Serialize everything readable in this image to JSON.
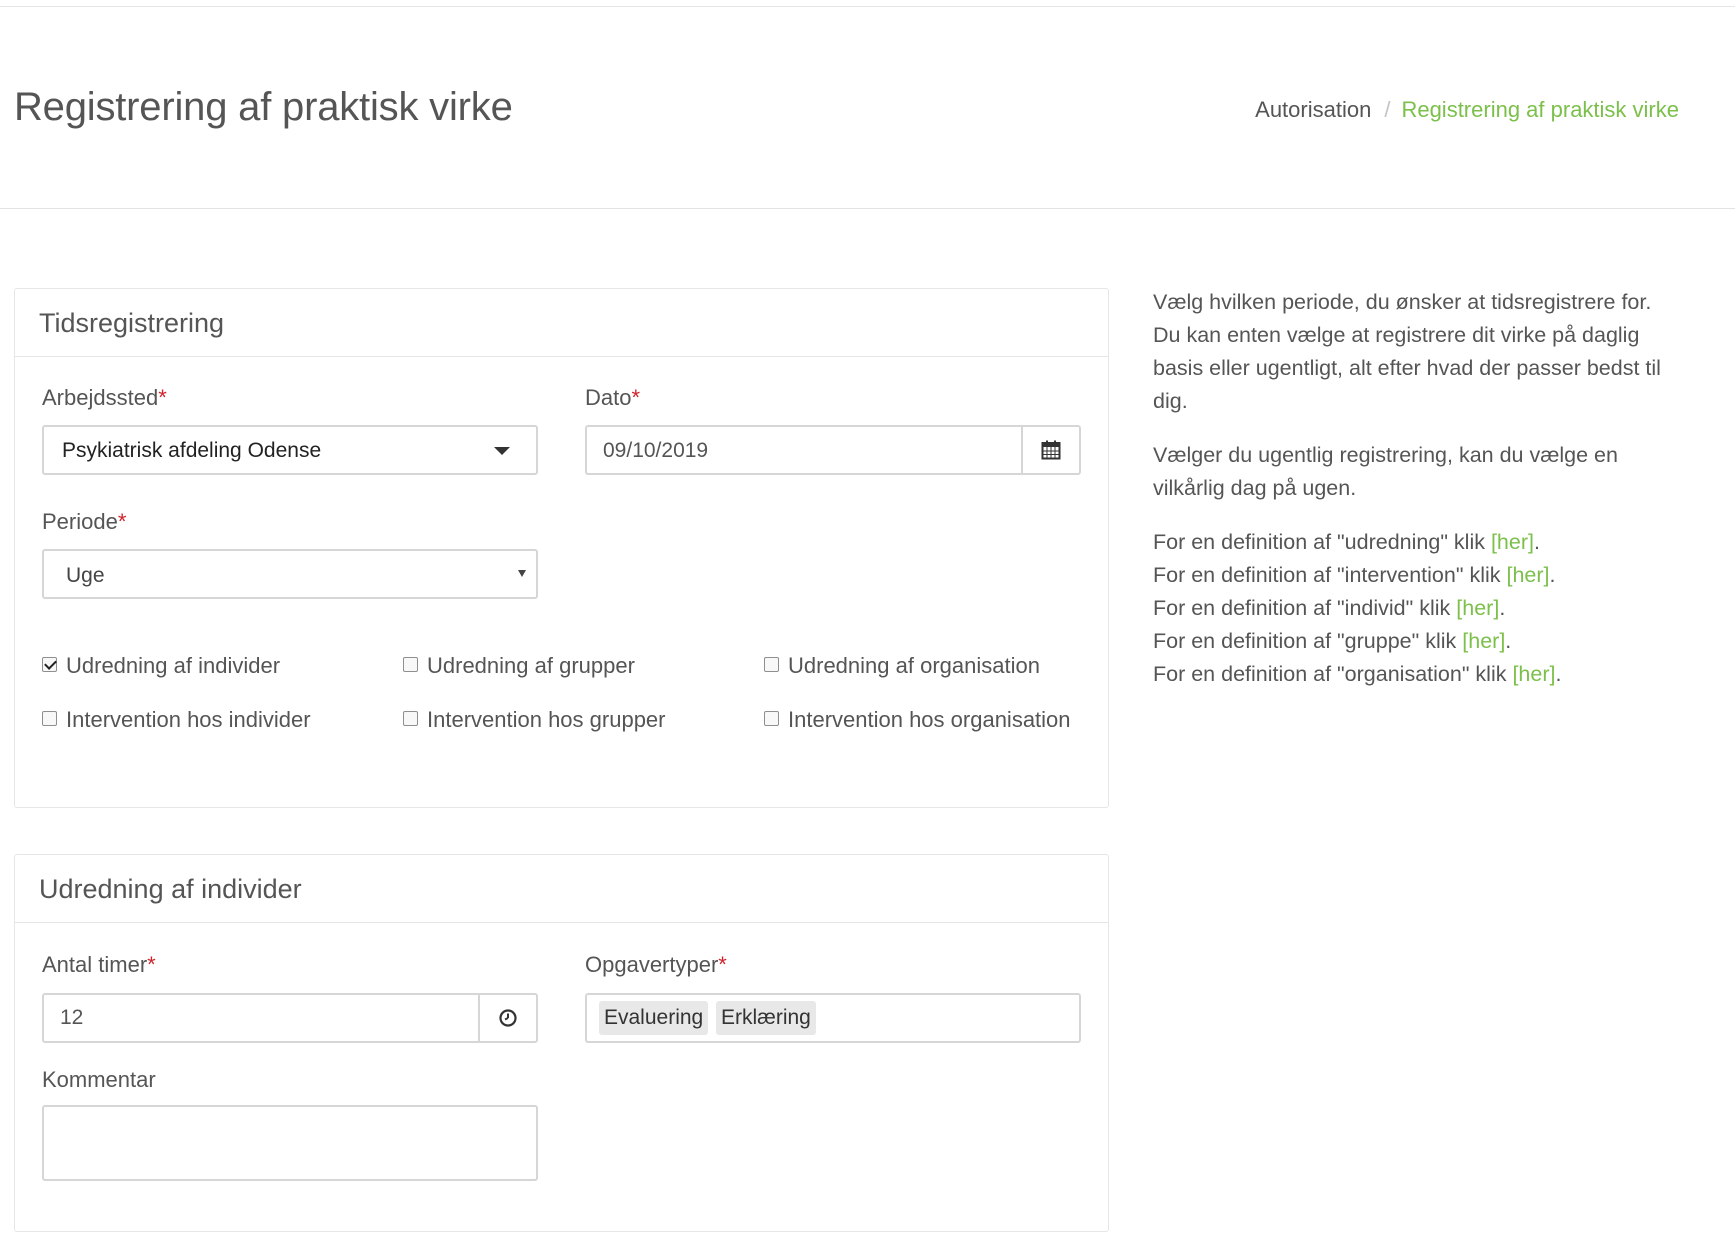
{
  "header": {
    "title": "Registrering af praktisk virke",
    "breadcrumb": {
      "root": "Autorisation",
      "separator": "/",
      "current": "Registrering af praktisk virke"
    }
  },
  "tidsregistrering": {
    "heading": "Tidsregistrering",
    "arbejdssted": {
      "label": "Arbejdssted",
      "required_mark": "*",
      "value": "Psykiatrisk afdeling Odense"
    },
    "dato": {
      "label": "Dato",
      "required_mark": "*",
      "value": "09/10/2019"
    },
    "periode": {
      "label": "Periode",
      "required_mark": "*",
      "value": "Uge"
    },
    "checkboxes": [
      {
        "label": "Udredning af individer",
        "checked": true
      },
      {
        "label": "Udredning af grupper",
        "checked": false
      },
      {
        "label": "Udredning af organisation",
        "checked": false
      },
      {
        "label": "Intervention hos individer",
        "checked": false
      },
      {
        "label": "Intervention hos grupper",
        "checked": false
      },
      {
        "label": "Intervention hos organisation",
        "checked": false
      }
    ]
  },
  "udredning_individer": {
    "heading": "Udredning af individer",
    "antal_timer": {
      "label": "Antal timer",
      "required_mark": "*",
      "value": "12"
    },
    "opgavertyper": {
      "label": "Opgavertyper",
      "required_mark": "*",
      "tags": [
        "Evaluering",
        "Erklæring"
      ]
    },
    "kommentar": {
      "label": "Kommentar",
      "value": ""
    }
  },
  "help": {
    "paragraph1": [
      "Vælg hvilken periode, du ønsker at tidsregistrere for.",
      "Du kan enten vælge at registrere dit virke på daglig",
      "basis eller ugentligt, alt efter hvad der passer bedst til",
      "dig."
    ],
    "paragraph2": [
      "Vælger du ugentlig registrering, kan du vælge en",
      "vilkårlig dag på ugen."
    ],
    "definitions": [
      {
        "text": "For en definition af \"udredning\" klik ",
        "link": "[her]",
        "end": "."
      },
      {
        "text": "For en definition af \"intervention\" klik ",
        "link": "[her]",
        "end": "."
      },
      {
        "text": "For en definition af \"individ\" klik ",
        "link": "[her]",
        "end": "."
      },
      {
        "text": "For en definition af \"gruppe\" klik ",
        "link": "[her]",
        "end": "."
      },
      {
        "text": "For en definition af \"organisation\" klik ",
        "link": "[her]",
        "end": "."
      }
    ]
  },
  "icons": {
    "calendar": "calendar-icon",
    "clock": "clock-icon",
    "caret": "caret-down-icon"
  }
}
